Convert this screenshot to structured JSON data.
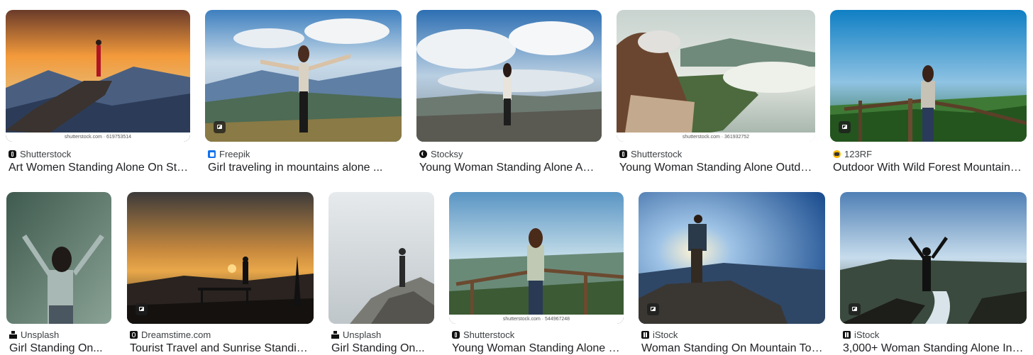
{
  "row1": [
    {
      "source": "Shutterstock",
      "favicon": "shutterstock-icon",
      "title": "Art Women Standing Alone On Sto...",
      "watermark": "shutterstock.com · 619753514"
    },
    {
      "source": "Freepik",
      "favicon": "freepik-icon",
      "title": "Girl traveling in mountains alone ...",
      "watermark": ""
    },
    {
      "source": "Stocksy",
      "favicon": "stocksy-icon",
      "title": "Young Woman Standing Alone Abo...",
      "watermark": ""
    },
    {
      "source": "Shutterstock",
      "favicon": "shutterstock-icon",
      "title": "Young Woman Standing Alone Outdoo...",
      "watermark": "shutterstock.com · 361932752"
    },
    {
      "source": "123RF",
      "favicon": "123rf-icon",
      "title": "Outdoor With Wild Forest Mountains ...",
      "watermark": ""
    }
  ],
  "row2": [
    {
      "source": "Unsplash",
      "favicon": "unsplash-icon",
      "title": "Girl Standing On..."
    },
    {
      "source": "Dreamstime.com",
      "favicon": "dreamstime-icon",
      "title": "Tourist Travel and Sunrise Standing..."
    },
    {
      "source": "Unsplash",
      "favicon": "unsplash-icon",
      "title": "Girl Standing On..."
    },
    {
      "source": "Shutterstock",
      "favicon": "shutterstock-icon",
      "title": "Young Woman Standing Alone On...",
      "watermark": "shutterstock.com · 544967248"
    },
    {
      "source": "iStock",
      "favicon": "istock-icon",
      "title": "Woman Standing On Mountain Top..."
    },
    {
      "source": "iStock",
      "favicon": "istock-icon",
      "title": "3,000+ Woman Standing Alone In T..."
    }
  ]
}
